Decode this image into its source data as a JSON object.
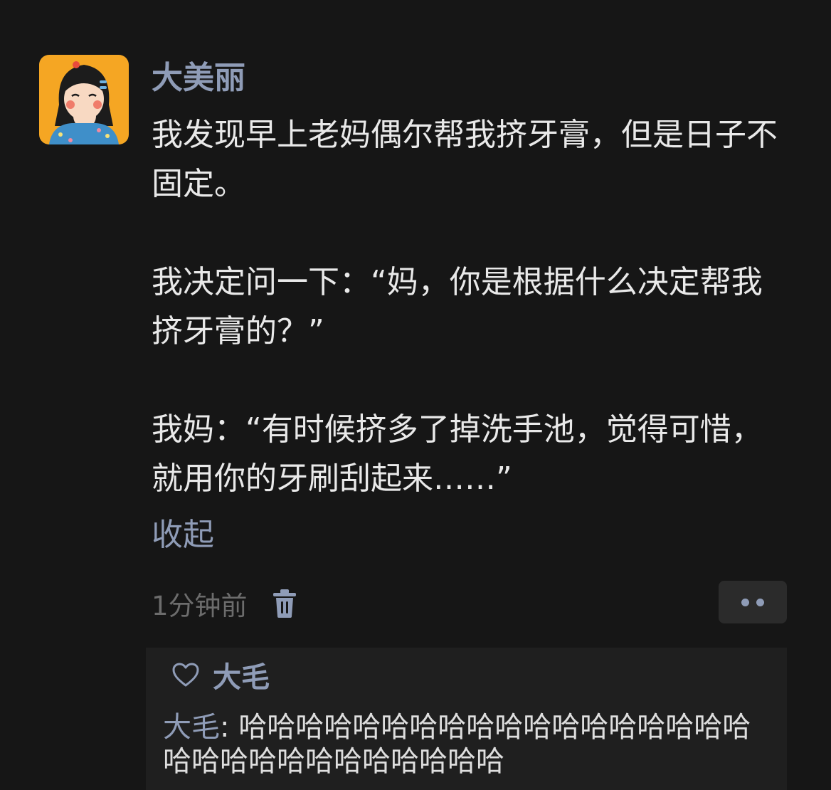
{
  "post": {
    "username": "大美丽",
    "paragraphs": [
      "我发现早上老妈偶尔帮我挤牙膏，但是日子不固定。",
      "我决定问一下：“妈，你是根据什么决定帮我挤牙膏的？”",
      "我妈：“有时候挤多了掉洗手池，觉得可惜，就用你的牙刷刮起来……”"
    ],
    "collapse_label": "收起",
    "time": "1分钟前",
    "delete_icon": "trash-icon",
    "more_icon": "more-dots-icon"
  },
  "likes": {
    "icon": "heart-outline-icon",
    "names": "大毛"
  },
  "comments": [
    {
      "author": "大毛",
      "separator": ": ",
      "text": "哈哈哈哈哈哈哈哈哈哈哈哈哈哈哈哈哈哈哈哈哈哈哈哈哈哈哈哈哈哈"
    }
  ],
  "colors": {
    "background": "#161616",
    "name_link": "#8f9cb7",
    "text": "#e9e9e9",
    "meta": "#6c6c6c",
    "comment_bg": "#1f1f1f"
  }
}
